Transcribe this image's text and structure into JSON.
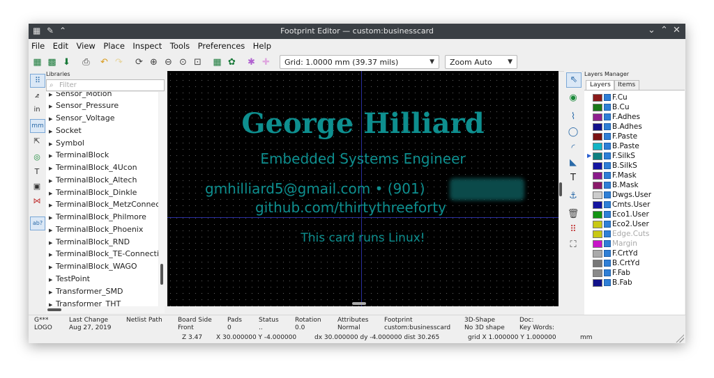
{
  "window": {
    "title": "Footprint Editor — custom:businesscard",
    "controls": {
      "minimize": "⌄",
      "maximize": "⌃",
      "close": "✕"
    }
  },
  "menu": [
    "File",
    "Edit",
    "View",
    "Place",
    "Inspect",
    "Tools",
    "Preferences",
    "Help"
  ],
  "toolbar": {
    "grid_value": "Grid: 1.0000 mm (39.37 mils)",
    "zoom_value": "Zoom Auto"
  },
  "left_toolbar": {
    "units_label": "mm",
    "in_label": "in"
  },
  "libraries": {
    "header": "Libraries",
    "filter_placeholder": "Filter",
    "items": [
      "Sensor_Motion",
      "Sensor_Pressure",
      "Sensor_Voltage",
      "Socket",
      "Symbol",
      "TerminalBlock",
      "TerminalBlock_4Ucon",
      "TerminalBlock_Altech",
      "TerminalBlock_Dinkle",
      "TerminalBlock_MetzConnect",
      "TerminalBlock_Philmore",
      "TerminalBlock_Phoenix",
      "TerminalBlock_RND",
      "TerminalBlock_TE-Connectivity",
      "TerminalBlock_WAGO",
      "TestPoint",
      "Transformer_SMD",
      "Transformer_THT"
    ]
  },
  "canvas": {
    "name": "George Hilliard",
    "role": "Embedded Systems Engineer",
    "email_phone": "gmhilliard5@gmail.com  •  (901)",
    "github": "github.com/thirtythreeforty",
    "tagline": "This card runs Linux!",
    "text_color": "#0e8f8f"
  },
  "layers_manager": {
    "header": "Layers Manager",
    "tabs": [
      "Layers",
      "Items"
    ],
    "layers": [
      {
        "name": "F.Cu",
        "color": "#8b1a1a"
      },
      {
        "name": "B.Cu",
        "color": "#1a7a1a"
      },
      {
        "name": "F.Adhes",
        "color": "#8e1f8e"
      },
      {
        "name": "B.Adhes",
        "color": "#12128a"
      },
      {
        "name": "F.Paste",
        "color": "#7a1212"
      },
      {
        "name": "B.Paste",
        "color": "#12b4c4"
      },
      {
        "name": "F.SilkS",
        "color": "#0f8080"
      },
      {
        "name": "B.SilkS",
        "color": "#1414a0"
      },
      {
        "name": "F.Mask",
        "color": "#8a1a8a"
      },
      {
        "name": "B.Mask",
        "color": "#8a1a6a"
      },
      {
        "name": "Dwgs.User",
        "color": "#cccccc"
      },
      {
        "name": "Cmts.User",
        "color": "#1414a0"
      },
      {
        "name": "Eco1.User",
        "color": "#149414"
      },
      {
        "name": "Eco2.User",
        "color": "#c8c814"
      },
      {
        "name": "Edge.Cuts",
        "color": "#c8c814"
      },
      {
        "name": "Margin",
        "color": "#c814c8"
      },
      {
        "name": "F.CrtYd",
        "color": "#aaaaaa"
      },
      {
        "name": "B.CrtYd",
        "color": "#777777"
      },
      {
        "name": "F.Fab",
        "color": "#8a8a8a"
      },
      {
        "name": "B.Fab",
        "color": "#12128a"
      }
    ]
  },
  "status": {
    "ref": "G***",
    "value": "LOGO",
    "last_change_label": "Last Change",
    "last_change": "Aug 27, 2019",
    "netlist_label": "Netlist Path",
    "board_side_label": "Board Side",
    "board_side": "Front",
    "pads_label": "Pads",
    "pads": "0",
    "status_label": "Status",
    "status_val": "..",
    "rotation_label": "Rotation",
    "rotation": "0.0",
    "attributes_label": "Attributes",
    "attributes": "Normal",
    "footprint_label": "Footprint",
    "footprint": "custom:businesscard",
    "shape_label": "3D-Shape",
    "shape": "No 3D shape",
    "doc_label": "Doc:",
    "keywords_label": "Key Words:",
    "zoom": "Z 3.47",
    "coords": "X 30.000000  Y -4.000000",
    "delta": "dx 30.000000  dy -4.000000  dist 30.265",
    "grid": "grid X 1.000000  Y 1.000000",
    "units": "mm"
  }
}
